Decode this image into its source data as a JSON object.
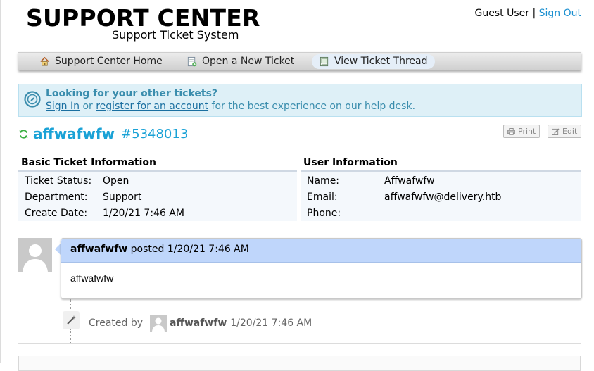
{
  "header": {
    "title": "SUPPORT CENTER",
    "subtitle": "Support Ticket System",
    "guest_label": "Guest User",
    "separator": "|",
    "sign_out": "Sign Out"
  },
  "nav": {
    "items": [
      {
        "label": "Support Center Home",
        "icon": "home-icon"
      },
      {
        "label": "Open a New Ticket",
        "icon": "new-ticket-icon"
      },
      {
        "label": "View Ticket Thread",
        "icon": "ticket-thread-icon",
        "active": true
      }
    ]
  },
  "banner": {
    "headline": "Looking for your other tickets?",
    "sign_in": "Sign In",
    "or": "or",
    "register": "register for an account",
    "suffix": "for the best experience on our help desk.",
    "icon": "compass-icon"
  },
  "ticket": {
    "subject": "affwafwfw",
    "number": "#5348013",
    "print_label": "Print",
    "edit_label": "Edit"
  },
  "basic_info": {
    "title": "Basic Ticket Information",
    "rows": [
      {
        "label": "Ticket Status:",
        "value": "Open"
      },
      {
        "label": "Department:",
        "value": "Support"
      },
      {
        "label": "Create Date:",
        "value": "1/20/21 7:46 AM"
      }
    ]
  },
  "user_info": {
    "title": "User Information",
    "rows": [
      {
        "label": "Name:",
        "value": "Affwafwfw"
      },
      {
        "label": "Email:",
        "value": "affwafwfw@delivery.htb"
      },
      {
        "label": "Phone:",
        "value": ""
      }
    ]
  },
  "thread": {
    "author": "affwafwfw",
    "posted": "posted",
    "date": "1/20/21 7:46 AM",
    "body": "affwafwfw"
  },
  "event": {
    "created_by": "Created by",
    "author": "affwafwfw",
    "date": "1/20/21 7:46 AM"
  },
  "colors": {
    "accent": "#1aa2d6",
    "link": "#1a8fd0",
    "banner_bg": "#def0f7",
    "thread_header": "#bfd6fb"
  }
}
